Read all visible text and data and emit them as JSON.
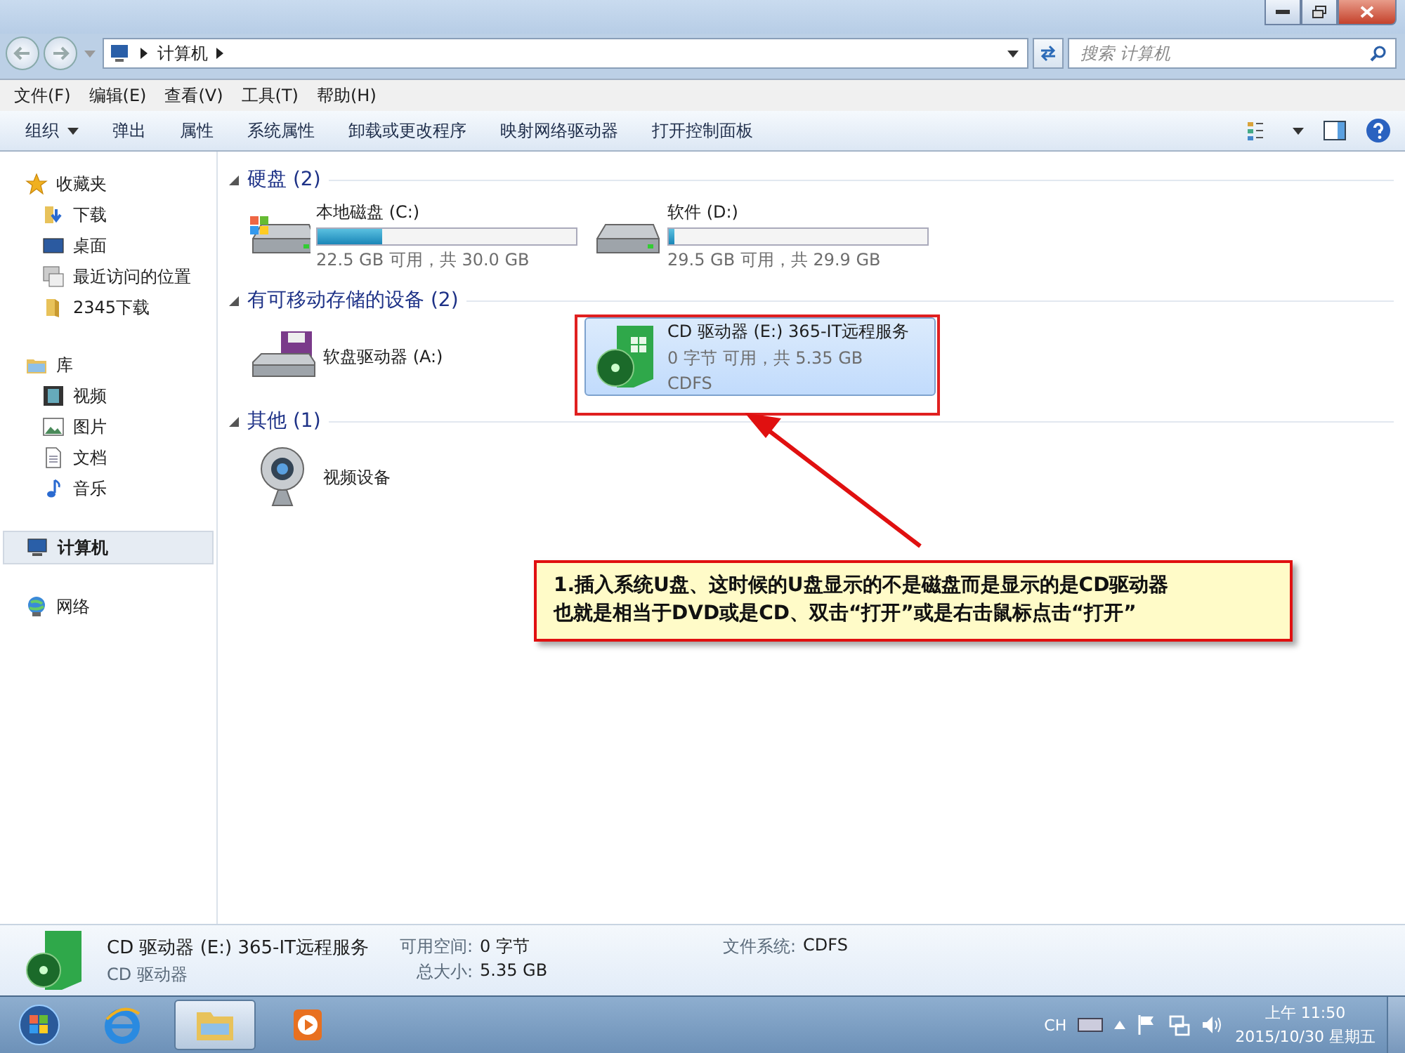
{
  "address": {
    "path": [
      "计算机"
    ]
  },
  "search": {
    "placeholder": "搜索 计算机"
  },
  "menu": [
    "文件(F)",
    "编辑(E)",
    "查看(V)",
    "工具(T)",
    "帮助(H)"
  ],
  "toolbar": [
    {
      "label": "组织",
      "kind": "menu"
    },
    {
      "label": "弹出",
      "kind": "button"
    },
    {
      "label": "属性",
      "kind": "button"
    },
    {
      "label": "系统属性",
      "kind": "button"
    },
    {
      "label": "卸载或更改程序",
      "kind": "button"
    },
    {
      "label": "映射网络驱动器",
      "kind": "button"
    },
    {
      "label": "打开控制面板",
      "kind": "button"
    }
  ],
  "sidebar": [
    {
      "label": "收藏夹",
      "kind": "star",
      "selected": false,
      "children": [
        {
          "label": "下载",
          "kind": "download",
          "selected": false
        },
        {
          "label": "桌面",
          "kind": "desktop",
          "selected": false
        },
        {
          "label": "最近访问的位置",
          "kind": "recent",
          "selected": false
        },
        {
          "label": "2345下载",
          "kind": "folder",
          "selected": false
        }
      ]
    },
    {
      "label": "库",
      "kind": "library",
      "selected": false,
      "children": [
        {
          "label": "视频",
          "kind": "video",
          "selected": false
        },
        {
          "label": "图片",
          "kind": "picture",
          "selected": false
        },
        {
          "label": "文档",
          "kind": "document",
          "selected": false
        },
        {
          "label": "音乐",
          "kind": "music",
          "selected": false
        }
      ]
    },
    {
      "label": "计算机",
      "kind": "computer",
      "selected": true
    },
    {
      "label": "网络",
      "kind": "network",
      "selected": false
    }
  ],
  "sections": [
    {
      "title": "硬盘",
      "count": "(2)",
      "items": [
        {
          "kind": "system-disk",
          "name": "本地磁盘 (C:)",
          "level": 0.25,
          "info": "22.5 GB 可用，共 30.0 GB",
          "selected": false
        },
        {
          "kind": "disk",
          "name": "软件 (D:)",
          "level": 0.02,
          "info": "29.5 GB 可用，共 29.9 GB",
          "selected": false
        }
      ]
    },
    {
      "title": "有可移动存储的设备",
      "count": "(2)",
      "items": [
        {
          "kind": "floppy",
          "name": "软盘驱动器 (A:)",
          "selected": false
        },
        {
          "kind": "cd",
          "name": "CD 驱动器 (E:) 365-IT远程服务",
          "info": "0 字节 可用，共 5.35 GB",
          "fs": "CDFS",
          "selected": true
        }
      ]
    },
    {
      "title": "其他",
      "count": "(1)",
      "items": [
        {
          "kind": "webcam",
          "name": "视频设备",
          "selected": false
        }
      ]
    }
  ],
  "callout": {
    "lines": [
      "1.插入系统U盘、这时候的U盘显示的不是磁盘而是显示的是CD驱动器",
      "也就是相当于DVD或是CD、双击“打开”或是右击鼠标点击“打开”"
    ]
  },
  "details": {
    "name": "CD 驱动器 (E:) 365-IT远程服务",
    "type": "CD 驱动器",
    "fields": [
      {
        "label": "可用空间:",
        "value": "0 字节"
      },
      {
        "label": "总大小:",
        "value": "5.35 GB"
      },
      {
        "label": "文件系统:",
        "value": "CDFS"
      }
    ]
  },
  "taskbar": {
    "apps": [
      {
        "kind": "ie",
        "selected": false
      },
      {
        "kind": "explorer",
        "selected": true
      },
      {
        "kind": "media",
        "selected": false
      }
    ],
    "language": "CH",
    "time": "上午 11:50",
    "date": "2015/10/30 星期五"
  }
}
